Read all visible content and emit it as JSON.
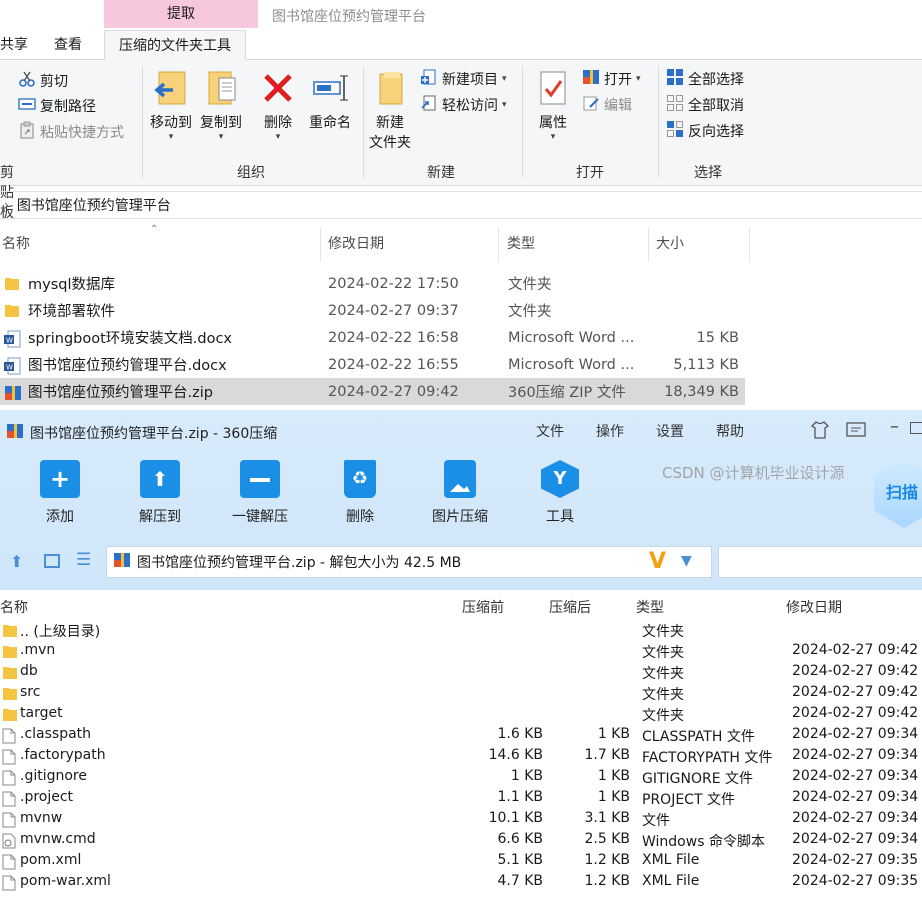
{
  "explorer": {
    "context_tab_header": "提取",
    "window_title": "图书馆座位预约管理平台",
    "tabs": [
      "共享",
      "查看",
      "压缩的文件夹工具"
    ],
    "ribbon": {
      "clipboard": {
        "cut": "剪切",
        "copy_path": "复制路径",
        "paste_shortcut": "粘贴快捷方式",
        "label": "剪贴板"
      },
      "organize": {
        "move_to": "移动到",
        "copy_to": "复制到",
        "delete": "删除",
        "rename": "重命名",
        "label": "组织"
      },
      "new": {
        "new_item": "新建项目",
        "easy_access": "轻松访问",
        "new_folder_1": "新建",
        "new_folder_2": "文件夹",
        "label": "新建"
      },
      "open": {
        "properties": "属性",
        "open": "打开",
        "edit": "编辑",
        "label": "打开"
      },
      "select": {
        "select_all": "全部选择",
        "select_none": "全部取消",
        "invert": "反向选择",
        "label": "选择"
      }
    },
    "address": "图书馆座位预约管理平台",
    "columns": {
      "name": "名称",
      "date": "修改日期",
      "type": "类型",
      "size": "大小"
    },
    "files": [
      {
        "name": "mysql数据库",
        "date": "2024-02-22 17:50",
        "type": "文件夹",
        "size": "",
        "icon": "folder-icon"
      },
      {
        "name": "环境部署软件",
        "date": "2024-02-27 09:37",
        "type": "文件夹",
        "size": "",
        "icon": "folder-icon"
      },
      {
        "name": "springboot环境安装文档.docx",
        "date": "2024-02-22 16:58",
        "type": "Microsoft Word ...",
        "size": "15 KB",
        "icon": "word-doc-icon"
      },
      {
        "name": "图书馆座位预约管理平台.docx",
        "date": "2024-02-22 16:55",
        "type": "Microsoft Word ...",
        "size": "5,113 KB",
        "icon": "word-doc-icon"
      },
      {
        "name": "图书馆座位预约管理平台.zip",
        "date": "2024-02-27 09:42",
        "type": "360压缩 ZIP 文件",
        "size": "18,349 KB",
        "icon": "zip-archive-icon",
        "selected": true
      }
    ]
  },
  "zip": {
    "title": "图书馆座位预约管理平台.zip - 360压缩",
    "menu": [
      "文件",
      "操作",
      "设置",
      "帮助"
    ],
    "toolbar": [
      "添加",
      "解压到",
      "一键解压",
      "删除",
      "图片压缩",
      "工具"
    ],
    "scan_badge": "扫描",
    "path": "图书馆座位预约管理平台.zip - 解包大小为 42.5 MB",
    "columns": {
      "name": "名称",
      "compressed": "压缩前",
      "original": "压缩后",
      "type": "类型",
      "date": "修改日期"
    },
    "rows": [
      {
        "name": ".. (上级目录)",
        "compressed": "",
        "original": "",
        "type": "文件夹",
        "date": "",
        "icon": "folder-icon"
      },
      {
        "name": ".mvn",
        "compressed": "",
        "original": "",
        "type": "文件夹",
        "date": "2024-02-27 09:42",
        "icon": "folder-icon"
      },
      {
        "name": "db",
        "compressed": "",
        "original": "",
        "type": "文件夹",
        "date": "2024-02-27 09:42",
        "icon": "folder-icon"
      },
      {
        "name": "src",
        "compressed": "",
        "original": "",
        "type": "文件夹",
        "date": "2024-02-27 09:42",
        "icon": "folder-icon"
      },
      {
        "name": "target",
        "compressed": "",
        "original": "",
        "type": "文件夹",
        "date": "2024-02-27 09:42",
        "icon": "folder-icon"
      },
      {
        "name": ".classpath",
        "compressed": "1.6 KB",
        "original": "1 KB",
        "type": "CLASSPATH 文件",
        "date": "2024-02-27 09:34",
        "icon": "file-icon"
      },
      {
        "name": ".factorypath",
        "compressed": "14.6 KB",
        "original": "1.7 KB",
        "type": "FACTORYPATH 文件",
        "date": "2024-02-27 09:34",
        "icon": "file-icon"
      },
      {
        "name": ".gitignore",
        "compressed": "1 KB",
        "original": "1 KB",
        "type": "GITIGNORE 文件",
        "date": "2024-02-27 09:34",
        "icon": "file-icon"
      },
      {
        "name": ".project",
        "compressed": "1.1 KB",
        "original": "1 KB",
        "type": "PROJECT 文件",
        "date": "2024-02-27 09:34",
        "icon": "file-icon"
      },
      {
        "name": "mvnw",
        "compressed": "10.1 KB",
        "original": "3.1 KB",
        "type": "文件",
        "date": "2024-02-27 09:34",
        "icon": "file-icon"
      },
      {
        "name": "mvnw.cmd",
        "compressed": "6.6 KB",
        "original": "2.5 KB",
        "type": "Windows 命令脚本",
        "date": "2024-02-27 09:34",
        "icon": "cmd-script-icon"
      },
      {
        "name": "pom.xml",
        "compressed": "5.1 KB",
        "original": "1.2 KB",
        "type": "XML File",
        "date": "2024-02-27 09:35",
        "icon": "file-icon"
      },
      {
        "name": "pom-war.xml",
        "compressed": "4.7 KB",
        "original": "1.2 KB",
        "type": "XML File",
        "date": "2024-02-27 09:35",
        "icon": "file-icon"
      }
    ]
  },
  "watermark": "CSDN @计算机毕业设计源"
}
